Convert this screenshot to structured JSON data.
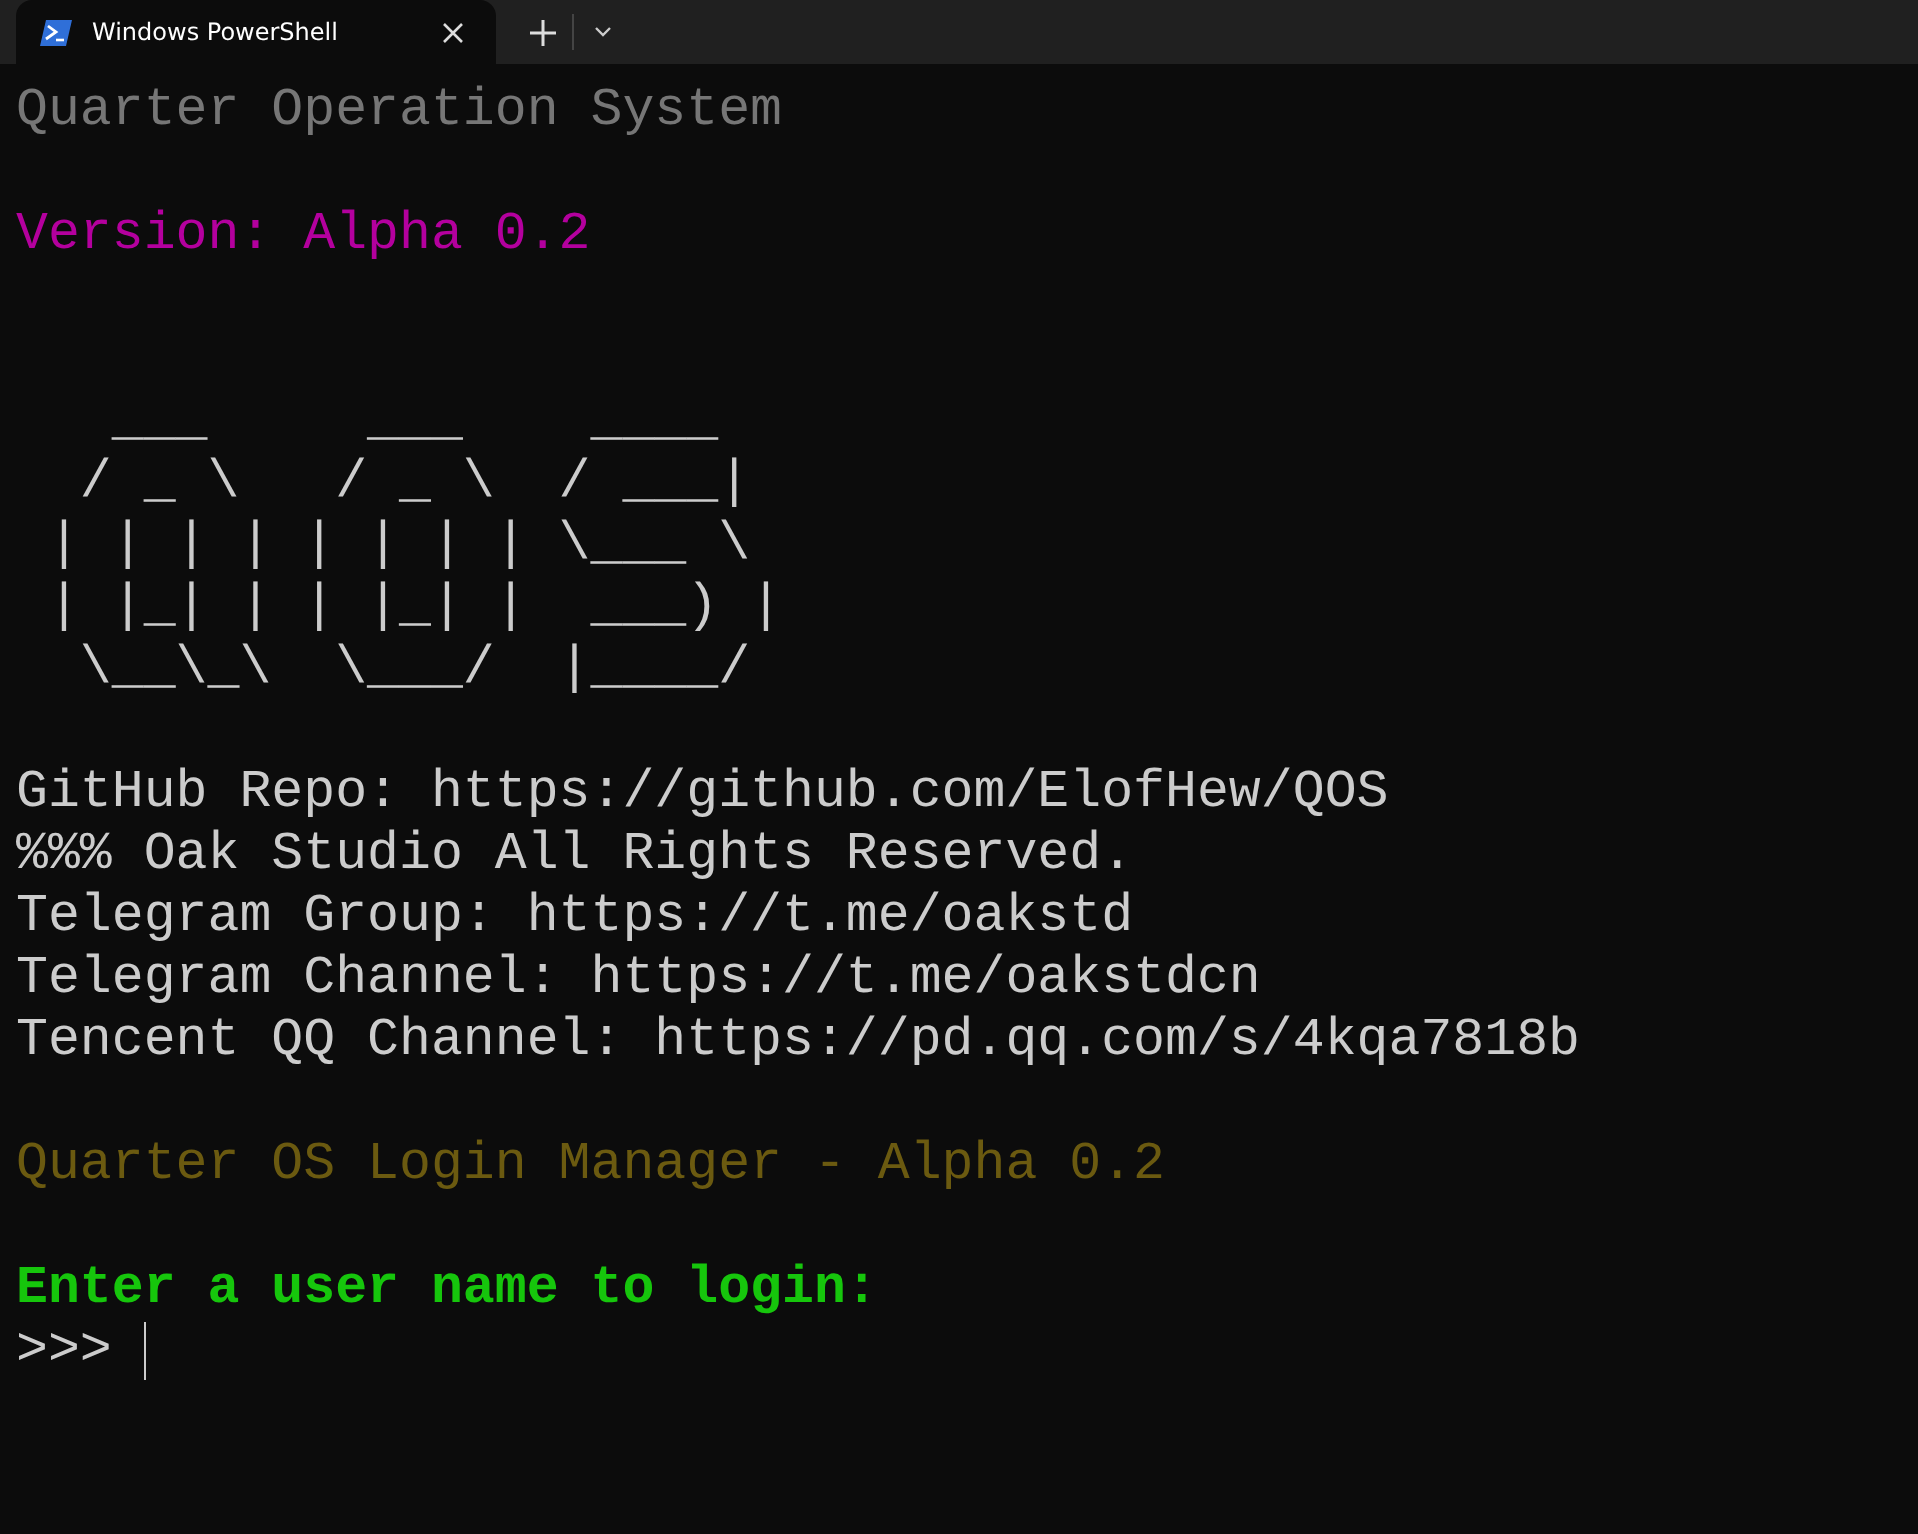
{
  "tab": {
    "title": "Windows PowerShell",
    "selected": true
  },
  "terminal": [
    {
      "kind": "title",
      "text": "Quarter Operation System"
    },
    {
      "kind": "version",
      "text": "Version: Alpha 0.2"
    },
    {
      "kind": "art",
      "text": "   ___     ___    ____\n  / _ \\   / _ \\  / ___|\n | | | | | | | | \\___ \\\n | |_| | | |_| |  ___) |\n  \\__\\_\\  \\___/  |____/"
    },
    {
      "kind": "info",
      "text": "GitHub Repo: https://github.com/ElofHew/QOS"
    },
    {
      "kind": "info",
      "text": "%%% Oak Studio All Rights Reserved."
    },
    {
      "kind": "info",
      "text": "Telegram Group: https://t.me/oakstd"
    },
    {
      "kind": "info",
      "text": "Telegram Channel: https://t.me/oakstdcn"
    },
    {
      "kind": "info",
      "text": "Tencent QQ Channel: https://pd.qq.com/s/4kqa7818b"
    },
    {
      "kind": "header",
      "text": "Quarter OS Login Manager - Alpha 0.2"
    },
    {
      "kind": "label",
      "text": "Enter a user name to login:"
    },
    {
      "kind": "prompt",
      "text": ">>>"
    }
  ]
}
